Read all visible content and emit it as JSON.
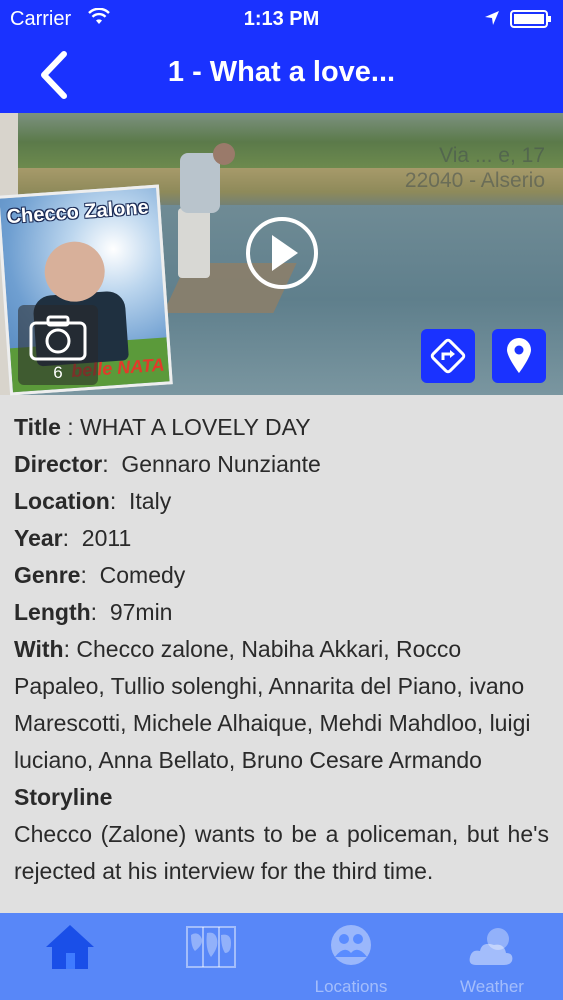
{
  "status_bar": {
    "carrier": "Carrier",
    "time": "1:13 PM"
  },
  "nav": {
    "title": "1 - What a love..."
  },
  "hero": {
    "address_line1": "Via ... e, 17",
    "address_line2": "22040 - Alserio",
    "poster_title": "Checco Zalone",
    "poster_subtitle": "belle NATA",
    "gallery_count": "6"
  },
  "details": {
    "title_label": "Title",
    "title_sep": " : ",
    "title_value": "WHAT A LOVELY DAY",
    "director_label": "Director",
    "director_value": "Gennaro Nunziante",
    "location_label": "Location",
    "location_value": "Italy",
    "year_label": "Year",
    "year_value": "2011",
    "genre_label": "Genre",
    "genre_value": "Comedy",
    "length_label": "Length",
    "length_value": "97min",
    "with_label": "With",
    "with_value": "Checco zalone, Nabiha Akkari, Rocco Papaleo, Tullio solenghi, Annarita del Piano, ivano Marescotti, Michele Alhaique, Mehdi Mahdloo, luigi luciano, Anna Bellato, Bruno Cesare Armando",
    "storyline_label": "Storyline",
    "storyline_value": "Checco (Zalone) wants to be a policeman, but he's rejected at his interview for the third time."
  },
  "tabs": {
    "home": "",
    "map": "",
    "locations": "Locations",
    "weather": "Weather"
  },
  "colors": {
    "accent_blue": "#1a32ff",
    "tab_bar": "#326eff"
  }
}
